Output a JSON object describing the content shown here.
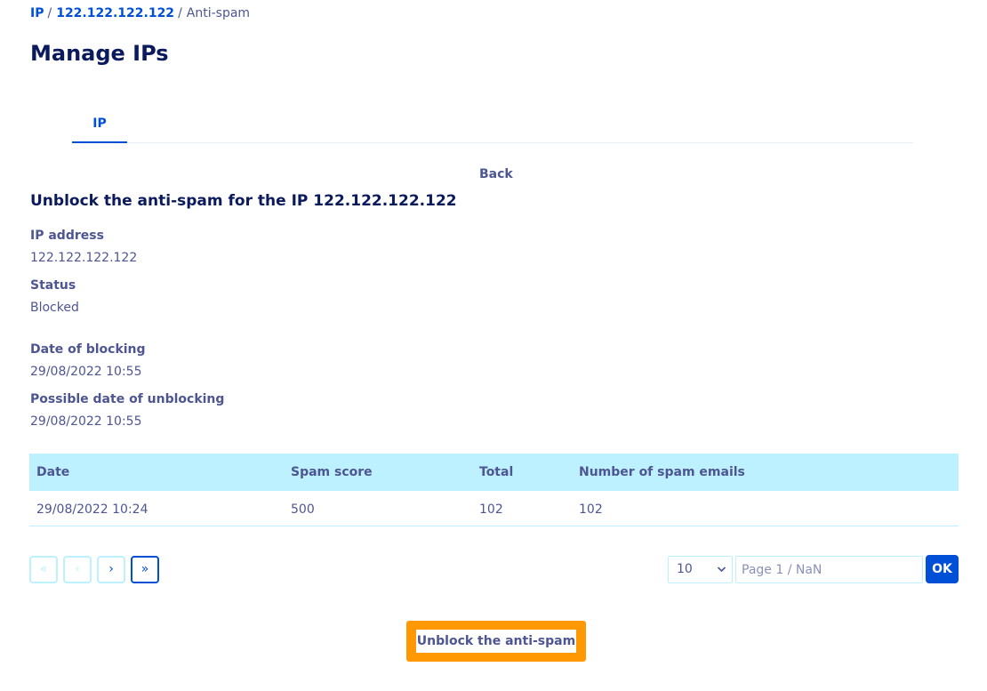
{
  "breadcrumb": {
    "items": [
      "IP",
      "122.122.122.122",
      "Anti-spam"
    ],
    "separator": "/"
  },
  "page_title": "Manage IPs",
  "tabs": [
    {
      "label": "IP",
      "active": true
    }
  ],
  "back_label": "Back",
  "section_title": "Unblock the anti-spam for the IP 122.122.122.122",
  "fields": {
    "ip_address": {
      "label": "IP address",
      "value": "122.122.122.122"
    },
    "status": {
      "label": "Status",
      "value": "Blocked"
    },
    "date_blocking": {
      "label": "Date of blocking",
      "value": "29/08/2022 10:55"
    },
    "date_unblocking": {
      "label": "Possible date of unblocking",
      "value": "29/08/2022 10:55"
    }
  },
  "table": {
    "headers": [
      "Date",
      "Spam score",
      "Total",
      "Number of spam emails"
    ],
    "rows": [
      [
        "29/08/2022 10:24",
        "500",
        "102",
        "102"
      ]
    ]
  },
  "pagination": {
    "first_icon": "double-chevron-left-icon",
    "prev_icon": "chevron-left-icon",
    "next_icon": "chevron-right-icon",
    "last_icon": "double-chevron-right-icon",
    "first_glyph": "«",
    "prev_glyph": "‹",
    "next_glyph": "›",
    "last_glyph": "»",
    "per_page": "10",
    "page_placeholder": "Page 1 / NaN",
    "ok_label": "OK"
  },
  "unblock_label": "Unblock the anti-spam",
  "colors": {
    "accent": "#0050d7",
    "header_bg": "#bef1ff",
    "highlight": "#ff9803",
    "text": "#4d5693",
    "title": "#0a1a5c"
  }
}
